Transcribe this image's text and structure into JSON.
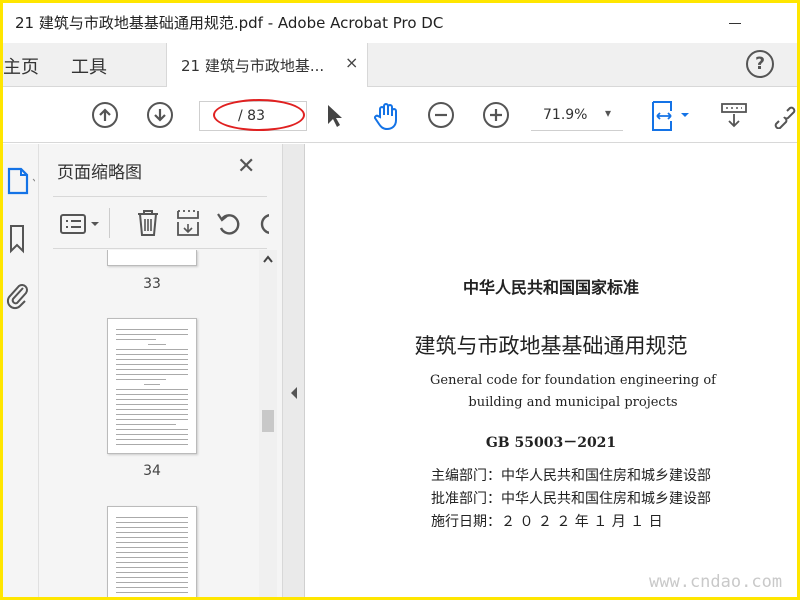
{
  "window": {
    "title": "21 建筑与市政地基基础通用规范.pdf - Adobe Acrobat Pro DC"
  },
  "tabs": {
    "home": "主页",
    "tools": "工具",
    "document": "21 建筑与市政地基...",
    "close": "×",
    "help": "?"
  },
  "toolbar": {
    "page_total": "/ 83",
    "zoom": "71.9%",
    "zoom_caret": "▾"
  },
  "thumbnails_panel": {
    "title": "页面缩略图",
    "close": "✕",
    "pages": [
      {
        "label": "33"
      },
      {
        "label": "34"
      }
    ]
  },
  "document": {
    "line1": "中华人民共和国国家标准",
    "line2": "建筑与市政地基基础通用规范",
    "english": "General code for foundation engineering of building and municipal projects",
    "code": "GB 55003－2021",
    "editor": "主编部门：中华人民共和国住房和城乡建设部",
    "approver": "批准部门：中华人民共和国住房和城乡建设部",
    "effective": "施行日期：２ ０ ２ ２ 年 １ 月 １ 日"
  },
  "watermark": "www.cndao.com",
  "colors": {
    "frame": "#ffe600",
    "annotation": "#e02020",
    "accent": "#1473e6",
    "icon": "#555555"
  },
  "icons": [
    "prev-page-icon",
    "next-page-icon",
    "select-pointer-icon",
    "hand-tool-icon",
    "zoom-out-icon",
    "zoom-in-icon",
    "fit-page-icon",
    "scroll-mode-icon",
    "link-icon",
    "thumbnails-icon",
    "bookmark-icon",
    "attachment-icon",
    "options-icon",
    "delete-icon",
    "extract-icon",
    "rotate-icon"
  ]
}
